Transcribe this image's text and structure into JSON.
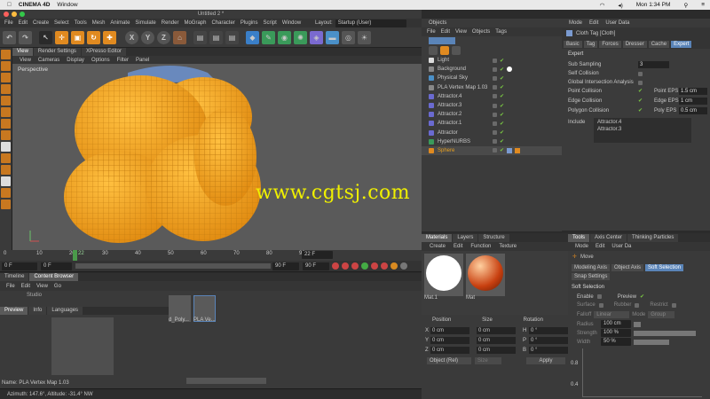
{
  "macbar": {
    "app": "CINEMA 4D",
    "menu": "Window",
    "time": "Mon 1:34 PM"
  },
  "window": {
    "title": "Untitled 2 *"
  },
  "app_menu": [
    "File",
    "Edit",
    "Create",
    "Select",
    "Tools",
    "Mesh",
    "Animate",
    "Simulate",
    "Render",
    "MoGraph",
    "Character",
    "Plugins",
    "Script",
    "Window"
  ],
  "layout": {
    "label": "Layout:",
    "value": "Startup (User)"
  },
  "viewport": {
    "tabs": [
      "View",
      "Render Settings",
      "XPresso Editor"
    ],
    "menu": [
      "View",
      "Cameras",
      "Display",
      "Options",
      "Filter",
      "Panel"
    ],
    "label": "Perspective",
    "watermark": "www.cgtsj.com"
  },
  "timeline": {
    "ticks": [
      "0",
      "10",
      "20",
      "30",
      "40",
      "50",
      "60",
      "70",
      "80",
      "90"
    ],
    "current": "22",
    "frame_field": "22 F",
    "start": "0 F",
    "start2": "0 F",
    "end": "90 F",
    "end2": "90 F"
  },
  "bottom_tabs": [
    "Timeline",
    "Content Browser"
  ],
  "content_browser": {
    "menu": [
      "File",
      "Edit",
      "View",
      "Go"
    ],
    "tree_item": "Studio",
    "tabs": [
      "Preview",
      "Info",
      "Languages"
    ],
    "thumbs": [
      "d_Poly...",
      "PLA Ve..."
    ],
    "name_label": "Name: PLA Vertex Map 1.03"
  },
  "status": "Azimuth: 147.6°, Altitude: -31.4°  NW",
  "objects": {
    "header": "Objects",
    "menu": [
      "File",
      "Edit",
      "View",
      "Objects",
      "Tags"
    ],
    "items": [
      {
        "name": "Light",
        "color": "#c8c8c8"
      },
      {
        "name": "Background",
        "color": "#c8c8c8"
      },
      {
        "name": "Physical Sky",
        "color": "#c8c8c8"
      },
      {
        "name": "PLA Vertex Map 1.03",
        "color": "#c8c8c8"
      },
      {
        "name": "Attractor.4",
        "color": "#c8c8c8"
      },
      {
        "name": "Attractor.3",
        "color": "#c8c8c8"
      },
      {
        "name": "Attractor.2",
        "color": "#c8c8c8"
      },
      {
        "name": "Attractor.1",
        "color": "#c8c8c8"
      },
      {
        "name": "Attractor",
        "color": "#c8c8c8"
      },
      {
        "name": "HyperNURBS",
        "color": "#c8c8c8"
      },
      {
        "name": "Sphere",
        "color": "#e8a020"
      }
    ]
  },
  "attributes": {
    "menu": [
      "Mode",
      "Edit",
      "User Data"
    ],
    "title": "Cloth Tag [Cloth]",
    "tabs": [
      "Basic",
      "Tag",
      "Forces",
      "Dresser",
      "Cache",
      "Expert"
    ],
    "section": "Expert",
    "sub_sampling_label": "Sub Sampling",
    "sub_sampling_value": "3",
    "self_collision": "Self Collision",
    "global_intersection": "Global Intersection Analysis",
    "point_collision": "Point Collision",
    "edge_collision": "Edge Collision",
    "polygon_collision": "Polygon Collision",
    "point_eps_label": "Point EPS",
    "point_eps_value": "1.5 cm",
    "edge_eps_label": "Edge EPS",
    "edge_eps_value": "1 cm",
    "poly_eps_label": "Poly EPS",
    "poly_eps_value": "0.5 cm",
    "include_label": "Include",
    "include_items": [
      "Attractor.4",
      "Attractor.3"
    ]
  },
  "material": {
    "tabs": [
      "Materials",
      "Layers",
      "Structure"
    ],
    "menu": [
      "Create",
      "Edit",
      "Function",
      "Texture"
    ],
    "swatches": [
      "Mat.1",
      "Mat"
    ]
  },
  "coords": {
    "headers": [
      "Position",
      "Size",
      "Rotation"
    ],
    "rows": [
      {
        "axis": "X",
        "pos": "0 cm",
        "size": "0 cm",
        "rot_label": "H",
        "rot": "0 °"
      },
      {
        "axis": "Y",
        "pos": "0 cm",
        "size": "0 cm",
        "rot_label": "P",
        "rot": "0 °"
      },
      {
        "axis": "Z",
        "pos": "0 cm",
        "size": "0 cm",
        "rot_label": "B",
        "rot": "0 °"
      }
    ],
    "mode": "Object (Rel)",
    "size_mode": "Size",
    "apply": "Apply"
  },
  "tools": {
    "tabs": [
      "Tools",
      "Axis Center",
      "Thinking Particles"
    ],
    "menu": [
      "Mode",
      "Edit",
      "User Da"
    ],
    "tool_name": "Move",
    "buttons": [
      "Modeling Axis",
      "Object Axis",
      "Soft Selection"
    ],
    "snap": "Snap Settings",
    "section": "Soft Selection",
    "enable": "Enable",
    "preview": "Preview",
    "surface": "Surface",
    "rubber": "Rubber",
    "restrict": "Restrict",
    "falloff_label": "Falloff",
    "falloff_value": "Linear",
    "mode_label": "Mode",
    "mode_value": "Group",
    "radius_label": "Radius",
    "radius_value": "100 cm",
    "strength_label": "Strength",
    "strength_value": "100 %",
    "width_label": "Width",
    "width_value": "50 %",
    "graph_labels": [
      "0.8",
      "0.4"
    ]
  },
  "colors": {
    "accent": "#5a84b8",
    "sphere": "#f5a623",
    "watermark": "#f0f000"
  }
}
